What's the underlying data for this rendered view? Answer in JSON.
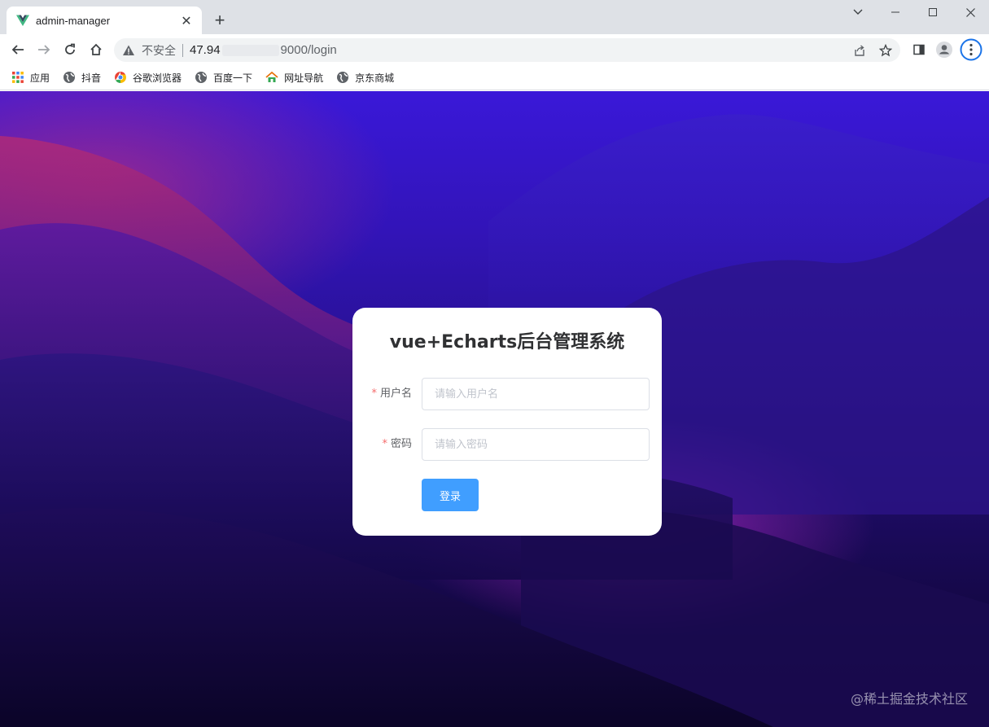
{
  "tab": {
    "title": "admin-manager"
  },
  "address_bar": {
    "security_label": "不安全",
    "url_prefix": "47.94",
    "url_suffix": "9000/login"
  },
  "bookmarks": [
    {
      "label": "应用",
      "icon": "apps-grid-icon"
    },
    {
      "label": "抖音",
      "icon": "globe-icon"
    },
    {
      "label": "谷歌浏览器",
      "icon": "chrome-icon"
    },
    {
      "label": "百度一下",
      "icon": "globe-icon"
    },
    {
      "label": "网址导航",
      "icon": "home-nav-icon"
    },
    {
      "label": "京东商城",
      "icon": "globe-icon"
    }
  ],
  "login": {
    "title": "vue+Echarts后台管理系统",
    "username_label": "用户名",
    "username_placeholder": "请输入用户名",
    "password_label": "密码",
    "password_placeholder": "请输入密码",
    "required_mark": "*",
    "submit_label": "登录"
  },
  "watermark": "@稀土掘金技术社区",
  "colors": {
    "primary_button": "#409eff",
    "required_mark": "#f56c6c",
    "card_background": "#ffffff"
  }
}
